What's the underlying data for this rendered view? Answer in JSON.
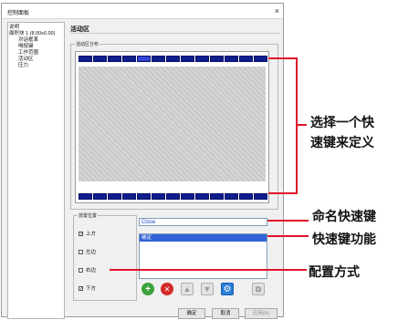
{
  "dialog": {
    "title": "控制面板",
    "close_glyph": "×"
  },
  "tree": {
    "items": [
      {
        "label": "说明",
        "level": 0
      },
      {
        "label": "面积块 1 (8.00x6.00)",
        "level": 0
      },
      {
        "label": "对话框革",
        "level": 1
      },
      {
        "label": "喝按键",
        "level": 1
      },
      {
        "label": "工作范围",
        "level": 1
      },
      {
        "label": "活动区",
        "level": 1
      },
      {
        "label": "压力",
        "level": 1
      }
    ]
  },
  "main": {
    "section_title": "活动区",
    "active_group_label": "活动区分布",
    "key_selected_index": 4,
    "placement": {
      "group_label": "放置位置",
      "options": [
        {
          "label": "上方",
          "checked": true
        },
        {
          "label": "左边",
          "checked": false
        },
        {
          "label": "右边",
          "checked": false
        },
        {
          "label": "下方",
          "checked": true
        }
      ]
    },
    "name_input": {
      "value": "Close"
    },
    "function_list": {
      "items": [
        {
          "label": "确定",
          "selected": true
        }
      ]
    },
    "toolbar_icons": [
      "add-icon",
      "delete-icon",
      "arrow-up-icon",
      "arrow-down-icon",
      "gear-icon",
      "copy-icon"
    ],
    "buttons": {
      "ok": "确定",
      "cancel": "取消",
      "apply": "应用(A)"
    }
  },
  "annotations": {
    "select_key": {
      "line1": "选择一个快",
      "line2": "速键来定义"
    },
    "name_key": "命名快速键",
    "key_function": "快速键功能",
    "config_mode": "配置方式",
    "color": "#e0142a"
  }
}
